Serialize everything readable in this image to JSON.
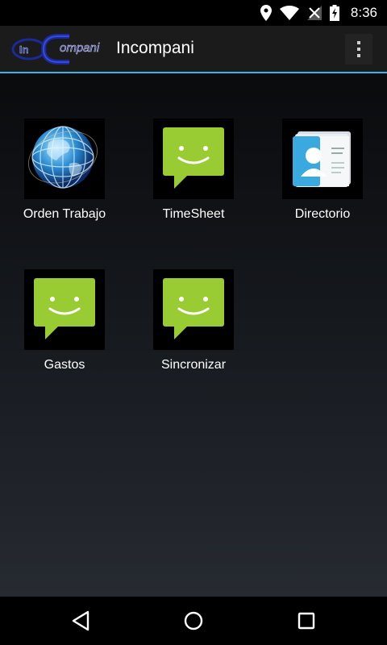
{
  "status_bar": {
    "time": "8:36",
    "icons": [
      "location-icon",
      "wifi-icon",
      "no-signal-icon",
      "battery-charging-icon"
    ]
  },
  "action_bar": {
    "logo_text": "In Compani",
    "title": "Incompani",
    "overflow_icon": "overflow-menu-icon"
  },
  "grid": {
    "items": [
      {
        "label": "Orden Trabajo",
        "icon": "globe-icon"
      },
      {
        "label": "TimeSheet",
        "icon": "chat-smile-icon"
      },
      {
        "label": "Directorio",
        "icon": "contacts-card-icon"
      },
      {
        "label": "Gastos",
        "icon": "chat-smile-icon"
      },
      {
        "label": "Sincronizar",
        "icon": "chat-smile-icon"
      }
    ]
  },
  "nav_bar": {
    "buttons": [
      "back-icon",
      "home-icon",
      "recents-icon"
    ]
  },
  "colors": {
    "accent": "#33b5e5",
    "chat_green": "#99cc33",
    "actionbar_bg": "#1b1b1b"
  }
}
